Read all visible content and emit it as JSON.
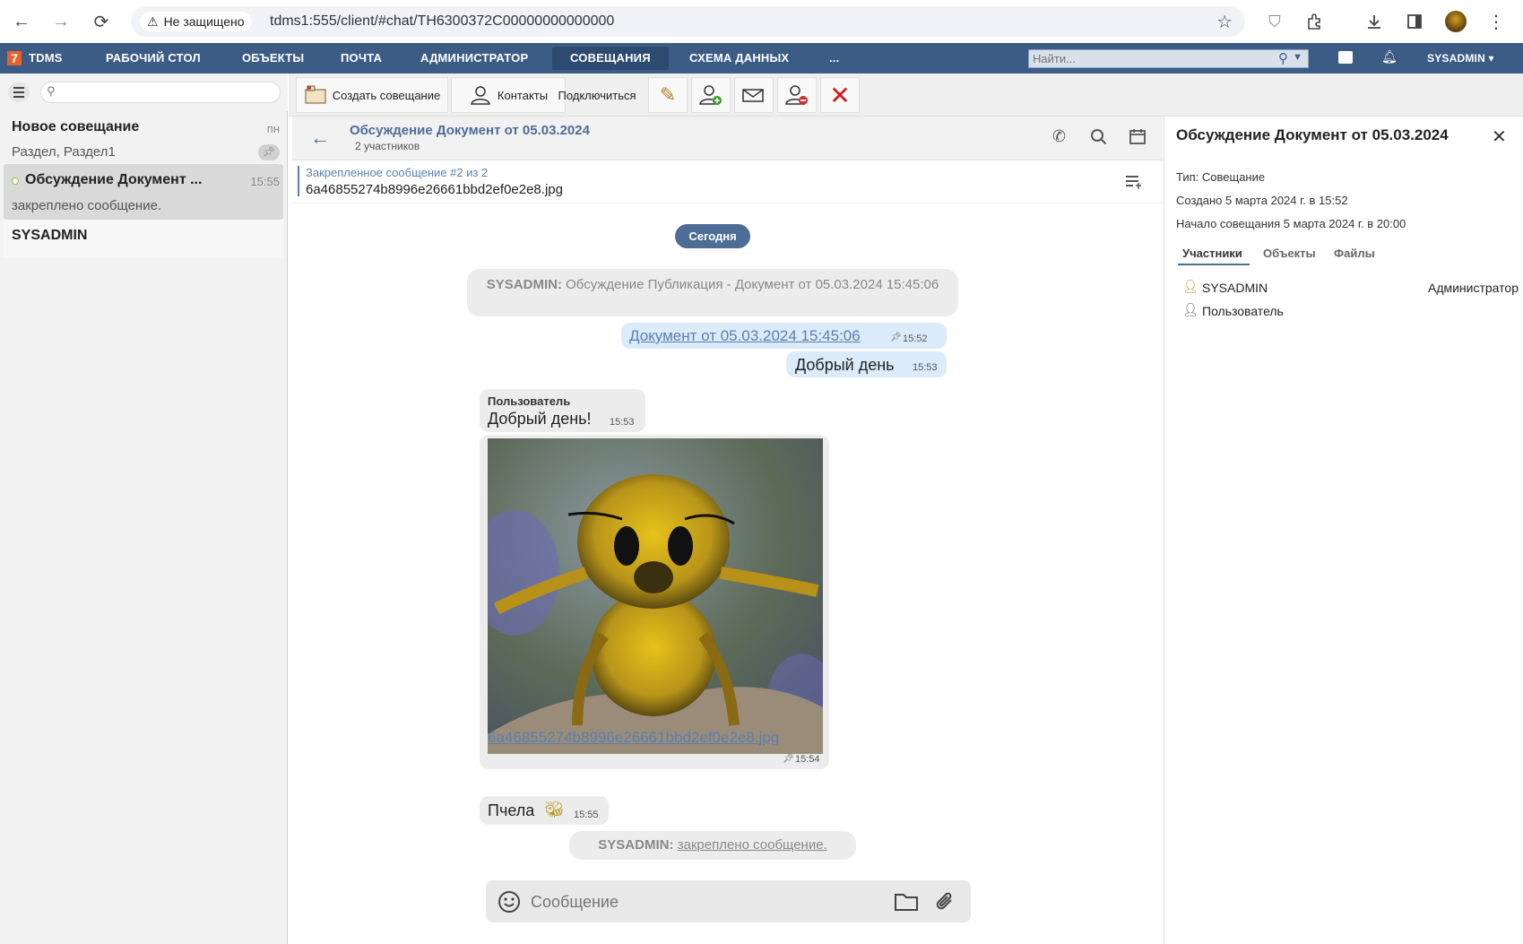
{
  "browser": {
    "security_label": "Не защищено",
    "url": "tdms1:555/client/#chat/TH6300372C00000000000000"
  },
  "appnav": {
    "logo_text": "TDMS",
    "items": [
      "РАБОЧИЙ СТОЛ",
      "ОБЪЕКТЫ",
      "ПОЧТА",
      "АДМИНИСТРАТОР",
      "СОВЕЩАНИЯ",
      "СХЕМА ДАННЫХ",
      "..."
    ],
    "active_item": "СОВЕЩАНИЯ",
    "search_placeholder": "Найти...",
    "user": "SYSADMIN"
  },
  "chat_list": [
    {
      "title": "Новое совещание",
      "time": "пн",
      "subtitle": "Раздел, Раздел1",
      "pinned": true
    },
    {
      "title": "Обсуждение Документ ...",
      "time": "15:55",
      "subtitle": "закреплено сообщение.",
      "online": true,
      "selected": true
    },
    {
      "title": "SYSADMIN",
      "time": "",
      "subtitle": ""
    }
  ],
  "toolbar": {
    "create_meeting": "Создать совещание",
    "contacts": "Контакты",
    "connect": "Подключиться"
  },
  "chat_header": {
    "title": "Обсуждение Документ от 05.03.2024",
    "participants": "2 участников"
  },
  "pinned": {
    "label": "Закрепленное сообщение #2 из 2",
    "text": "6a46855274b8996e26661bbd2ef0e2e8.jpg"
  },
  "messages": {
    "date_badge": "Сегодня",
    "system1_author": "SYSADMIN:",
    "system1_text": "Обсуждение Публикация - Документ от 05.03.2024 15:45:06",
    "out1_link": "Документ от 05.03.2024 15:45:06",
    "out1_time": "15:52",
    "out2_text": "Добрый день",
    "out2_time": "15:53",
    "in_author": "Пользователь",
    "in1_text": "Добрый день!",
    "in1_time": "15:53",
    "image_link": "6a46855274b8996e26661bbd2ef0e2e8.jpg",
    "image_time": "15:54",
    "in2_text": "Пчела",
    "in2_time": "15:55",
    "system2_author": "SYSADMIN:",
    "system2_text": "закреплено сообщение."
  },
  "composer": {
    "placeholder": "Сообщение"
  },
  "details": {
    "title": "Обсуждение Документ от 05.03.2024",
    "type": "Тип: Совещание",
    "created": "Создано 5 марта 2024 г. в 15:52",
    "start": "Начало совещания 5 марта 2024 г. в 20:00",
    "tabs": [
      "Участники",
      "Объекты",
      "Файлы"
    ],
    "active_tab": "Участники",
    "participants": [
      {
        "name": "SYSADMIN",
        "role": "Администратор"
      },
      {
        "name": "Пользователь",
        "role": ""
      }
    ]
  },
  "colors": {
    "nav_bg": "#3c5c86",
    "accent": "#4e6d96",
    "link": "#5a7fb0",
    "bubble_out": "#dcebfa",
    "bubble_in": "#ececec"
  }
}
